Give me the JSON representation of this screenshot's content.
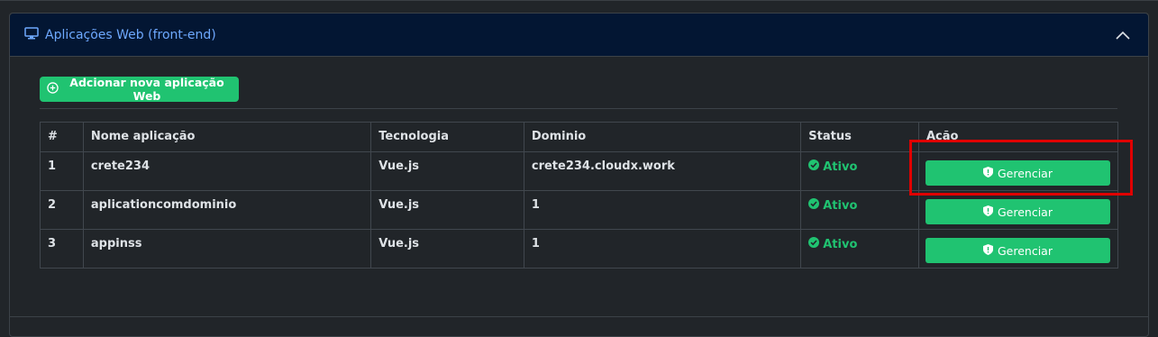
{
  "section": {
    "title": "Aplicações Web (front-end)",
    "icon": "monitor-icon",
    "collapse_icon": "chevron-up-icon"
  },
  "add_button": {
    "label": "Adcionar nova aplicação Web",
    "icon": "plus-circle-icon"
  },
  "table": {
    "headers": [
      "#",
      "Nome aplicação",
      "Tecnologia",
      "Dominio",
      "Status",
      "Ação"
    ],
    "rows": [
      {
        "index": "1",
        "name": "crete234",
        "tech": "Vue.js",
        "domain": "crete234.cloudx.work",
        "status": "Ativo",
        "action": "Gerenciar"
      },
      {
        "index": "2",
        "name": "aplicationcomdominio",
        "tech": "Vue.js",
        "domain": "1",
        "status": "Ativo",
        "action": "Gerenciar"
      },
      {
        "index": "3",
        "name": "appinss",
        "tech": "Vue.js",
        "domain": "1",
        "status": "Ativo",
        "action": "Gerenciar"
      }
    ]
  },
  "colors": {
    "accent_green": "#20c371",
    "header_bg": "#031633",
    "title_blue": "#6ea8fe",
    "highlight_red": "#e00000"
  }
}
